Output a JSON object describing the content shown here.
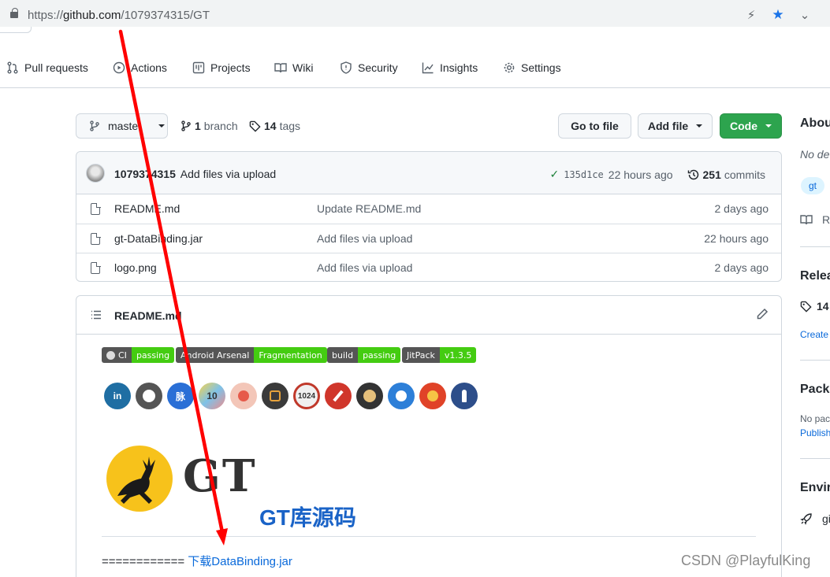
{
  "browser": {
    "url_prefix": "https://",
    "url_host": "github.com",
    "url_path": "/1079374315/GT"
  },
  "repo_nav": {
    "items": [
      {
        "label": "Pull requests",
        "icon": "pull-request-icon"
      },
      {
        "label": "Actions",
        "icon": "play-icon"
      },
      {
        "label": "Projects",
        "icon": "project-icon"
      },
      {
        "label": "Wiki",
        "icon": "book-icon"
      },
      {
        "label": "Security",
        "icon": "shield-icon"
      },
      {
        "label": "Insights",
        "icon": "graph-icon"
      },
      {
        "label": "Settings",
        "icon": "gear-icon"
      }
    ]
  },
  "toolbar": {
    "branch_button": "maste",
    "branch_count": "1",
    "branch_label": "branch",
    "tags_count": "14",
    "tags_label": "tags",
    "go_to_file": "Go to file",
    "add_file": "Add file",
    "code": "Code"
  },
  "commit": {
    "author": "1079374315",
    "message": "Add files via upload",
    "sha": "135d1ce",
    "time": "22 hours ago",
    "commits_count": "251",
    "commits_label": "commits"
  },
  "files": [
    {
      "name": "README.md",
      "message": "Update README.md",
      "age": "2 days ago"
    },
    {
      "name": "gt-DataBinding.jar",
      "message": "Add files via upload",
      "age": "22 hours ago"
    },
    {
      "name": "logo.png",
      "message": "Add files via upload",
      "age": "2 days ago"
    }
  ],
  "readme": {
    "filename": "README.md",
    "badges": [
      {
        "left": "CI",
        "right": "passing",
        "color": "#4c1"
      },
      {
        "left": "Android Arsenal",
        "right": "Fragmentation",
        "color": "#4c1"
      },
      {
        "left": "build",
        "right": "passing",
        "color": "#4c1"
      },
      {
        "left": "JitPack",
        "right": "v1.3.5",
        "color": "#4c1"
      }
    ],
    "social_icons": [
      {
        "name": "linkedin-icon",
        "text": "in",
        "color": "#1f6ea3"
      },
      {
        "name": "github-icon",
        "text": "",
        "color": "#555"
      },
      {
        "name": "maimai-icon",
        "text": "脉",
        "color": "#2a6fd6"
      },
      {
        "name": "app10-icon",
        "text": "10",
        "color": "#e8c24a"
      },
      {
        "name": "monkey-icon",
        "text": "",
        "color": "#f07c6c"
      },
      {
        "name": "juejin-icon",
        "text": "",
        "color": "#3a3a3a"
      },
      {
        "name": "oschina-icon",
        "text": "1024",
        "color": "#c0392b"
      },
      {
        "name": "pen-icon",
        "text": "",
        "color": "#d0362b"
      },
      {
        "name": "shield-badge-icon",
        "text": "",
        "color": "#333"
      },
      {
        "name": "astronaut-icon",
        "text": "",
        "color": "#2d7fd8"
      },
      {
        "name": "chrome-red-icon",
        "text": "",
        "color": "#e04328"
      },
      {
        "name": "rocket-icon",
        "text": "",
        "color": "#2d4e8a"
      }
    ],
    "logo_text": "GT",
    "subtitle": "GT库源码",
    "download_prefix": "============",
    "download_link": "下载DataBinding.jar"
  },
  "sidebar": {
    "about": "Abou",
    "no_desc": "No de",
    "topic": "gt",
    "readme_short": "R",
    "releases": "Relea",
    "releases_count": "14",
    "create": "Create",
    "packages": "Packa",
    "no_packages": "No pac",
    "publish": "Publish",
    "environments": "Enviro",
    "env_item": "gi"
  },
  "watermark": "CSDN @PlayfulKing",
  "colors": {
    "accent_blue": "#0969da",
    "green_button": "#2da44e",
    "arrow_red": "#ff0000"
  }
}
